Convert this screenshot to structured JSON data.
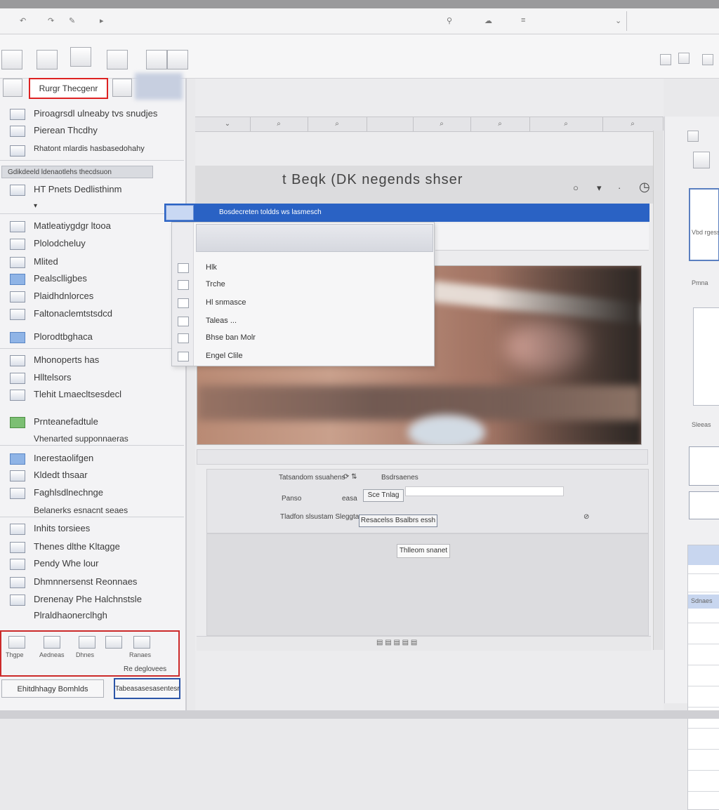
{
  "search": {
    "label": "Rurgr Thecgenr"
  },
  "sidebar": {
    "header_items": [
      {
        "label": "Piroagrsdl ulneaby tvs snudjes"
      },
      {
        "label": "Pierean Thcdhy"
      },
      {
        "label": "Rhatont mlardis hasbasedohahy"
      }
    ],
    "selected_row": "Gdikdeeld ldenaotlehs thecdsuon",
    "items": [
      {
        "label": "HT Pnets Dedlisthinm"
      },
      {
        "label": "Matleatiygdgr ltooa"
      },
      {
        "label": "Plolodcheluy"
      },
      {
        "label": "Mlited"
      },
      {
        "label": "Pealsclligbes"
      },
      {
        "label": "Plaidhdnlorces"
      },
      {
        "label": "Faltonaclemtstsdcd"
      },
      {
        "label": "Plorodtbghaca"
      },
      {
        "label": "Mhonoperts has"
      },
      {
        "label": "Hlltelsors"
      },
      {
        "label": "Tlehit  Lmaecltsesdecl"
      },
      {
        "label": "Prnteanefadtule"
      },
      {
        "label": "Vhenarted  supponnaeras"
      },
      {
        "label": "Inerestaolifgen"
      },
      {
        "label": "Kldedt thsaar"
      },
      {
        "label": "Faghlsdlnechnge"
      },
      {
        "label": "Belanerks  esnacnt seaes"
      },
      {
        "label": "Inhits  torsiees"
      },
      {
        "label": "Thenes dlthe  Kltagge"
      },
      {
        "label": "Pendy  Whe lour"
      },
      {
        "label": "Dhmnnersenst  Reonnaes"
      },
      {
        "label": "Drenenay Phe  Halchnstsle"
      },
      {
        "label": "Plraldhaonerclhgh"
      }
    ],
    "bottom_icons": [
      {
        "label": "Thgpe"
      },
      {
        "label": "Aedneas"
      },
      {
        "label": "Dhnes"
      },
      {
        "label": ""
      },
      {
        "label": "Ranaes"
      }
    ],
    "bottom_note": "Re deglovees",
    "left_button": "Ehitdhhagy Bomhlds",
    "right_button": "Tabeasasesasentesr"
  },
  "document": {
    "title": "t  Beqk  (DK  negends  shser",
    "blue_bar_title": "Bosdecreten  toldds  ws  lasmesch",
    "dropdown_items": [
      {
        "label": "Hlk"
      },
      {
        "label": "Trche"
      },
      {
        "label": "Hl      snmasce"
      },
      {
        "label": "Taleas  ..."
      },
      {
        "label": "Bhse  ban  Molr"
      },
      {
        "label": "Engel   Clile"
      }
    ],
    "form": {
      "row1_label": "Tatsandom  ssuahens",
      "row1_extra": "Bsdrsaenes",
      "row2_label": "Panso",
      "row2_mid": "easa",
      "row2_button": "Sce  Tnlag",
      "row3_label": "Tladfon  slsustam  Sleggtas",
      "row3_button": "Resacelss  Bsalbrs  essh",
      "ok_button": "Thlleom  snanet"
    }
  },
  "right_panel": {
    "thumb1_label": "Vbd rgessl",
    "label2": "Pmna",
    "label3": "Sleeas",
    "label4": "Sdnaes"
  },
  "colors": {
    "accent_blue": "#2a62c4",
    "highlight_red": "#cc2a2a",
    "sidebar_bg": "#f3f3f5"
  }
}
